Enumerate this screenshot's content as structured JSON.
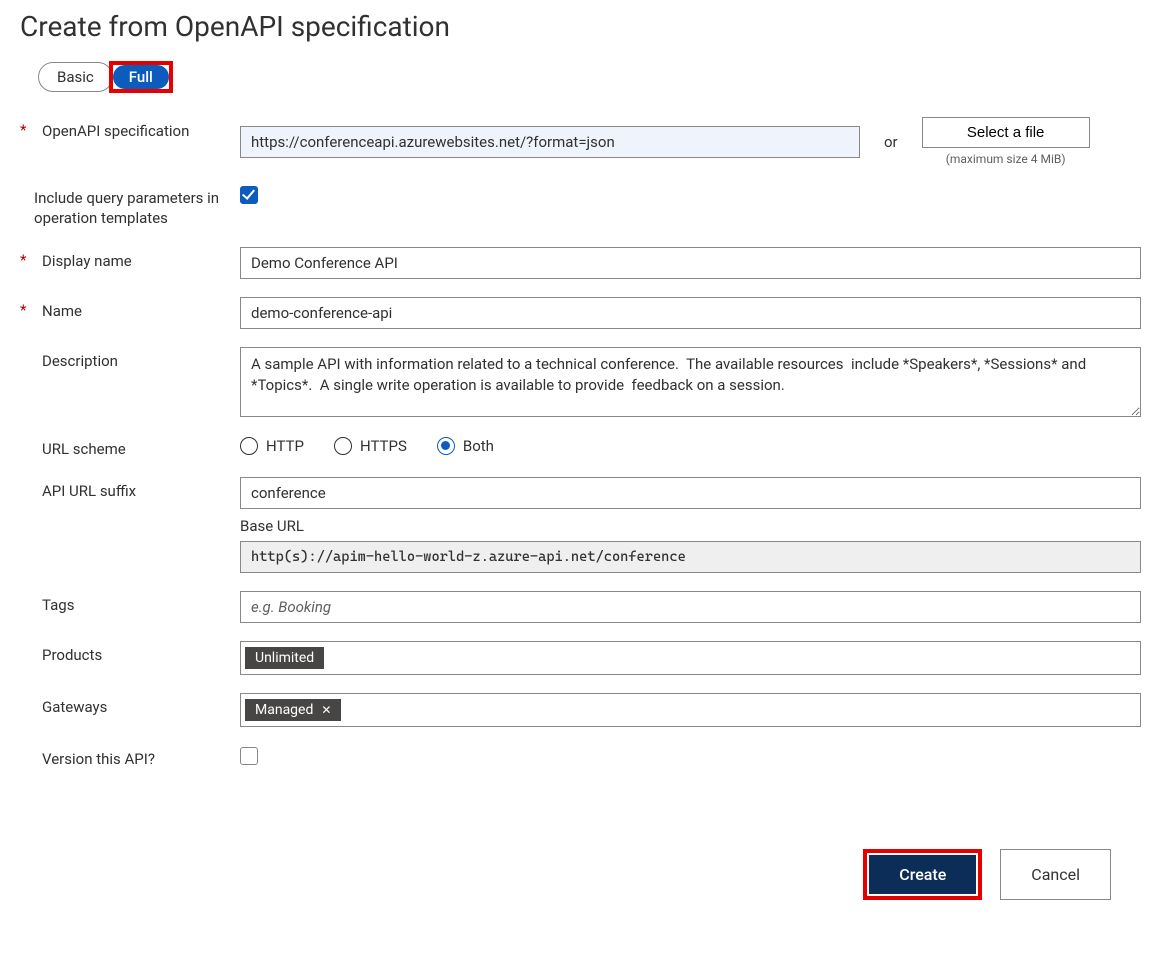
{
  "title": "Create from OpenAPI specification",
  "toggle": {
    "basic": "Basic",
    "full": "Full",
    "selected": "full"
  },
  "fields": {
    "openapi_spec": {
      "label": "OpenAPI specification",
      "value": "https://conferenceapi.azurewebsites.net/?format=json",
      "or": "or",
      "select_file": "Select a file",
      "max_hint": "(maximum size 4 MiB)"
    },
    "include_query": {
      "label": "Include query parameters in operation templates",
      "checked": true
    },
    "display_name": {
      "label": "Display name",
      "value": "Demo Conference API"
    },
    "name": {
      "label": "Name",
      "value": "demo-conference-api"
    },
    "description": {
      "label": "Description",
      "value": "A sample API with information related to a technical conference.  The available resources  include *Speakers*, *Sessions* and *Topics*.  A single write operation is available to provide  feedback on a session."
    },
    "url_scheme": {
      "label": "URL scheme",
      "options": {
        "http": "HTTP",
        "https": "HTTPS",
        "both": "Both"
      },
      "selected": "both"
    },
    "suffix": {
      "label": "API URL suffix",
      "value": "conference"
    },
    "base_url": {
      "label": "Base URL",
      "value": "http(s)://apim-hello-world-z.azure-api.net/conference"
    },
    "tags": {
      "label": "Tags",
      "placeholder": "e.g. Booking"
    },
    "products": {
      "label": "Products",
      "chips": [
        "Unlimited"
      ]
    },
    "gateways": {
      "label": "Gateways",
      "chips": [
        "Managed"
      ],
      "removable": true
    },
    "version": {
      "label": "Version this API?",
      "checked": false
    }
  },
  "footer": {
    "create": "Create",
    "cancel": "Cancel"
  }
}
